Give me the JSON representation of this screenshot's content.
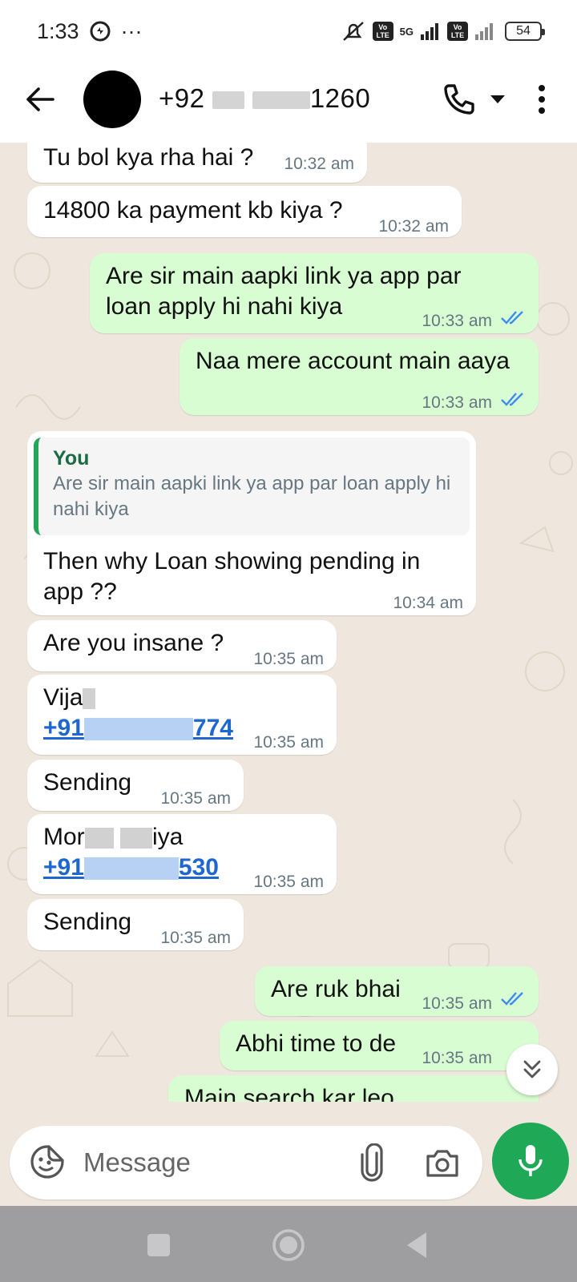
{
  "status_bar": {
    "time": "1:33",
    "more": "···",
    "network": "5G",
    "volte_label": "Vo LTE",
    "battery": "54"
  },
  "header": {
    "contact_prefix": "+92",
    "contact_suffix": "1260"
  },
  "messages": [
    {
      "direction": "in",
      "text": "Tu bol kya rha hai ?",
      "time": "10:32 am"
    },
    {
      "direction": "in",
      "text": "14800 ka payment kb kiya ?",
      "time": "10:32 am"
    },
    {
      "direction": "out",
      "text": "Are sir main aapki link ya app par loan apply hi nahi kiya",
      "time": "10:33 am",
      "status": "read"
    },
    {
      "direction": "out",
      "text": "Naa mere account main aaya",
      "time": "10:33 am",
      "status": "read"
    },
    {
      "direction": "in",
      "quote_author": "You",
      "quote_text": "Are sir main aapki link ya app par loan apply hi nahi kiya",
      "text": "Then why Loan showing pending in app ??",
      "time": "10:34 am"
    },
    {
      "direction": "in",
      "text": "Are you insane ?",
      "time": "10:35 am"
    },
    {
      "direction": "in",
      "name_visible": "Vija",
      "phone_prefix": "+91",
      "phone_suffix": "774",
      "time": "10:35 am"
    },
    {
      "direction": "in",
      "text": "Sending",
      "time": "10:35 am"
    },
    {
      "direction": "in",
      "name_prefix": "Mor",
      "name_suffix": "iya",
      "phone_prefix": "+91",
      "phone_suffix": "530",
      "time": "10:35 am"
    },
    {
      "direction": "in",
      "text": "Sending",
      "time": "10:35 am"
    },
    {
      "direction": "out",
      "text": "Are ruk bhai",
      "time": "10:35 am",
      "status": "read"
    },
    {
      "direction": "out",
      "text": "Abhi time to de",
      "time": "10:35 am",
      "status": "read"
    },
    {
      "direction": "out",
      "text": "Main search kar leo",
      "time": "",
      "status": "partial"
    }
  ],
  "composer": {
    "placeholder": "Message"
  },
  "colors": {
    "incoming": "#ffffff",
    "outgoing": "#d9fdd3",
    "chat_bg": "#efe7dd",
    "accent": "#1fa855",
    "tick_blue": "#3f8cf0"
  },
  "icons": [
    "back-arrow-icon",
    "phone-icon",
    "chevron-down-icon",
    "more-vert-icon",
    "double-check-icon",
    "chevrons-down-icon",
    "sticker-icon",
    "paperclip-icon",
    "camera-icon",
    "mic-icon",
    "nav-square-icon",
    "nav-circle-icon",
    "nav-triangle-icon"
  ]
}
